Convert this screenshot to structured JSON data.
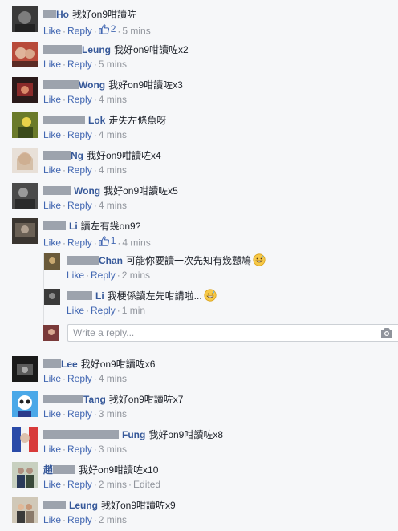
{
  "actions": {
    "like": "Like",
    "reply": "Reply",
    "separator": "·"
  },
  "comments": [
    {
      "name_suffix": "Ho",
      "text": "我好on9咁讀咗",
      "time": "5 mins",
      "likes": "2"
    },
    {
      "name_suffix": "Leung",
      "text": "我好on9咁讀咗x2",
      "time": "5 mins"
    },
    {
      "name_suffix": "Wong",
      "text": "我好on9咁讀咗x3",
      "time": "4 mins"
    },
    {
      "name_suffix": "Lok",
      "text": "走失左條魚呀",
      "time": "4 mins"
    },
    {
      "name_suffix": "Ng",
      "text": "我好on9咁讀咗x4",
      "time": "4 mins"
    },
    {
      "name_suffix": "Wong",
      "text": "我好on9咁讀咗x5",
      "time": "4 mins"
    },
    {
      "name_suffix": "Li",
      "text": "讀左有幾on9?",
      "time": "4 mins",
      "likes": "1"
    },
    {
      "name_suffix": "Lee",
      "text": "我好on9咁讀咗x6",
      "time": "4 mins"
    },
    {
      "name_suffix": "Tang",
      "text": "我好on9咁讀咗x7",
      "time": "3 mins"
    },
    {
      "name_suffix": "Fung",
      "text": "我好on9咁讀咗x8",
      "time": "3 mins"
    },
    {
      "name_prefix": "趙",
      "text": "我好on9咁讀咗x10",
      "time": "2 mins",
      "edited": "Edited"
    },
    {
      "name_suffix": "Leung",
      "text": "我好on9咁讀咗x9",
      "time": "2 mins"
    }
  ],
  "replies": [
    {
      "name_suffix": "Chan",
      "text": "可能你要讀一次先知有幾戇鳩",
      "time": "2 mins",
      "emoji": "grinning-sweat-emoji"
    },
    {
      "name_suffix": "Li",
      "text": "我梗係讀左先咁講啦...",
      "time": "1 min",
      "emoji": "grinning-sweat-emoji"
    }
  ],
  "reply_box": {
    "placeholder": "Write a reply...",
    "icons": [
      "camera-icon",
      "smiley-icon"
    ]
  },
  "colors": {
    "name": "#365899",
    "action": "#4267b2",
    "meta": "#90949c",
    "background": "#f6f7f9"
  }
}
